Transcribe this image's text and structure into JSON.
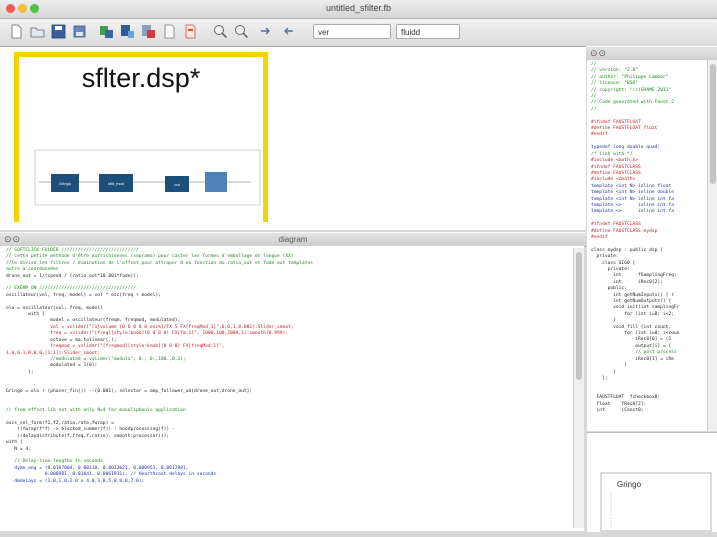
{
  "window": {
    "title": "untitled_sfilter.fb"
  },
  "toolbar": {
    "select1": "ver",
    "select2": "fluidd"
  },
  "preview": {
    "title": "sflter.dsp*",
    "blocks": [
      "Gringo",
      "sfilt_mod",
      "out",
      ""
    ]
  },
  "editor": {
    "title": "diagram"
  },
  "right_svg": {
    "label": "Gringo"
  },
  "colors": {
    "frame": "#f3d400",
    "block_fill": "#1d4f7c",
    "block_light": "#4e82b8"
  },
  "code": {
    "lines": [
      {
        "t": "// SOFTCLICK FOLDER ////////////////////////////",
        "c": "c-com"
      },
      {
        "t": "// cette petite méthode d'être autrichiennes (sopramo) pour caster les formes d'emballage et longue (XX)",
        "c": "c-com"
      },
      {
        "t": "//le divisé les filtres / diminution de l'offset pour attraper 8 en fonction du ratio_out et fade out templates",
        "c": "c-com"
      },
      {
        "t": "autre à coordonnées",
        "c": "c-com"
      },
      {
        "t": "drone_out = 1/(speed / (ratio_out*10.001*fade));",
        "c": ""
      },
      {
        "t": "",
        "c": ""
      },
      {
        "t": "// EXEMP ON ///////////////////////////////////",
        "c": "c-com"
      },
      {
        "t": "oscillateur(vol, freq, model) = vol * osc(freq + model);",
        "c": ""
      },
      {
        "t": "",
        "c": ""
      },
      {
        "t": "olo = oscillateur(vol, freq, model)",
        "c": ""
      },
      {
        "t": "        with {",
        "c": ""
      },
      {
        "t": "                model = oscillateur(freqm, freqmod, modulated);",
        "c": ""
      },
      {
        "t": "                vol = vslider(\"[1]volume [0 0 0 0 0 osc%]/FX S FX[freqMod:1]\",0,0,1,0.001):Slider_smoot;",
        "c": "c-red"
      },
      {
        "t": "                freq = vslider(\"[freq][style:knob][0 0 0 0] FX[fm:1]\", 1000,100,2000,1):smooth(0.999);",
        "c": "c-red"
      },
      {
        "t": "                octave = ma.tolinear(.);",
        "c": ""
      },
      {
        "t": "                freqmod = vslider(\"[freqmod][style:knob][0 0 0] FX[freqMod:1]\",",
        "c": "c-red"
      },
      {
        "t": "1,0,0.1,0.0,0,[1:1]):Slider_smoot;",
        "c": "c-red"
      },
      {
        "t": "                //modulated = vslider(\"modula\", 0., 0.,100.,0.1);",
        "c": "c-com"
      },
      {
        "t": "                modulated = 1(0);",
        "c": ""
      },
      {
        "t": "        };",
        "c": ""
      },
      {
        "t": "",
        "c": ""
      },
      {
        "t": "",
        "c": ""
      },
      {
        "t": "Gringo = olo + (phaser_fin()) --(0.001); selector = amp_follower_ud(drone_out,drone_out);",
        "c": ""
      },
      {
        "t": "",
        "c": ""
      },
      {
        "t": "",
        "c": ""
      },
      {
        "t": "// from offset.lib not with only N=4 for monoliphonic application",
        "c": "c-com"
      },
      {
        "t": "",
        "c": ""
      },
      {
        "t": "oscs_sel_form(f1,f2,ratio,rate,fwrap) =",
        "c": ""
      },
      {
        "t": "    ((fwrap(f*f) -> blocked_summer(f)) : hoodprocessing(f)) -",
        "c": ""
      },
      {
        "t": "    ((delaydistribute(f,freq,f,ratio), smooth:processor());",
        "c": ""
      },
      {
        "t": "with {",
        "c": ""
      },
      {
        "t": "   N = 4;",
        "c": ""
      },
      {
        "t": "",
        "c": ""
      },
      {
        "t": "   // Delay-line lengths in seconds",
        "c": "c-com"
      },
      {
        "t": "   dymn_ang = (0.0107004, 0.00110, 0.0013621, 0.000951, 0.0012981,",
        "c": "c-blue"
      },
      {
        "t": "              0.000981, 0.01041, 0.0061911); // Hearthcoat delays in seconds",
        "c": "c-blue"
      },
      {
        "t": "   dmdelays = (1.0,1.0,2.0 x 4.0,3.0,5.0,0.0,7.0);",
        "c": "c-blue"
      }
    ],
    "cpp": [
      {
        "t": "//",
        "c": "c-com"
      },
      {
        "t": "// version: \"2.0\"",
        "c": "c-com"
      },
      {
        "t": "// author: \"Philippe Lamber\"",
        "c": "c-com"
      },
      {
        "t": "// license: \"BSD\"",
        "c": "c-com"
      },
      {
        "t": "// copyright: \"(c)GRAME 2011\"",
        "c": "c-com"
      },
      {
        "t": "//",
        "c": "c-com"
      },
      {
        "t": "// Code generated with Faust 2",
        "c": "c-com"
      },
      {
        "t": "//",
        "c": "c-com"
      },
      {
        "t": "",
        "c": ""
      },
      {
        "t": "#ifndef FAUSTFLOAT",
        "c": "c-red"
      },
      {
        "t": "#define FAUSTFLOAT float",
        "c": "c-red"
      },
      {
        "t": "#endif",
        "c": "c-red"
      },
      {
        "t": "",
        "c": ""
      },
      {
        "t": "typedef long double quad;",
        "c": "c-blue"
      },
      {
        "t": "/* link with */",
        "c": "c-com"
      },
      {
        "t": "#include <math.h>",
        "c": "c-red"
      },
      {
        "t": "#ifndef FAUSTCLASS",
        "c": "c-red"
      },
      {
        "t": "#define FAUSTCLASS",
        "c": "c-red"
      },
      {
        "t": "#include <cmath>",
        "c": "c-red"
      },
      {
        "t": "template <int N> inline float",
        "c": "c-blue"
      },
      {
        "t": "template <int N> inline double",
        "c": "c-blue"
      },
      {
        "t": "template <int N> inline int fa",
        "c": "c-blue"
      },
      {
        "t": "template <>      inline int fa",
        "c": "c-blue"
      },
      {
        "t": "template <>      inline int fa",
        "c": "c-blue"
      },
      {
        "t": "",
        "c": ""
      },
      {
        "t": "#ifndef FAUSTCLASS",
        "c": "c-red"
      },
      {
        "t": "#define FAUSTCLASS mydsp",
        "c": "c-red"
      },
      {
        "t": "#endif",
        "c": "c-red"
      },
      {
        "t": "",
        "c": ""
      },
      {
        "t": "class mydsp : public dsp {",
        "c": ""
      },
      {
        "t": "  private:",
        "c": ""
      },
      {
        "t": "    class SIG0 {",
        "c": ""
      },
      {
        "t": "      private:",
        "c": ""
      },
      {
        "t": "        int      fSamplingFreq;",
        "c": ""
      },
      {
        "t": "        int      iRec0[2];",
        "c": ""
      },
      {
        "t": "      public:",
        "c": ""
      },
      {
        "t": "        int getNumInputs() { r",
        "c": ""
      },
      {
        "t": "        int getNumOutputs() {",
        "c": ""
      },
      {
        "t": "        void init(int samplingFr",
        "c": ""
      },
      {
        "t": "            for (int i=0; i<2;",
        "c": ""
      },
      {
        "t": "        }",
        "c": ""
      },
      {
        "t": "        void fill (int count,",
        "c": ""
      },
      {
        "t": "            for (int i=0; i<coun",
        "c": ""
      },
      {
        "t": "                iRec0[0] = (1",
        "c": ""
      },
      {
        "t": "                output[i] = (",
        "c": ""
      },
      {
        "t": "                // post process",
        "c": "c-com"
      },
      {
        "t": "                iRec0[1] = iRe",
        "c": ""
      },
      {
        "t": "            }",
        "c": ""
      },
      {
        "t": "        }",
        "c": ""
      },
      {
        "t": "    };",
        "c": ""
      },
      {
        "t": "",
        "c": ""
      },
      {
        "t": "",
        "c": ""
      },
      {
        "t": "  FAUSTFLOAT  fcheckbox0;",
        "c": ""
      },
      {
        "t": "  float    fRec0[2];",
        "c": ""
      },
      {
        "t": "  int      iConst0;",
        "c": ""
      }
    ]
  }
}
